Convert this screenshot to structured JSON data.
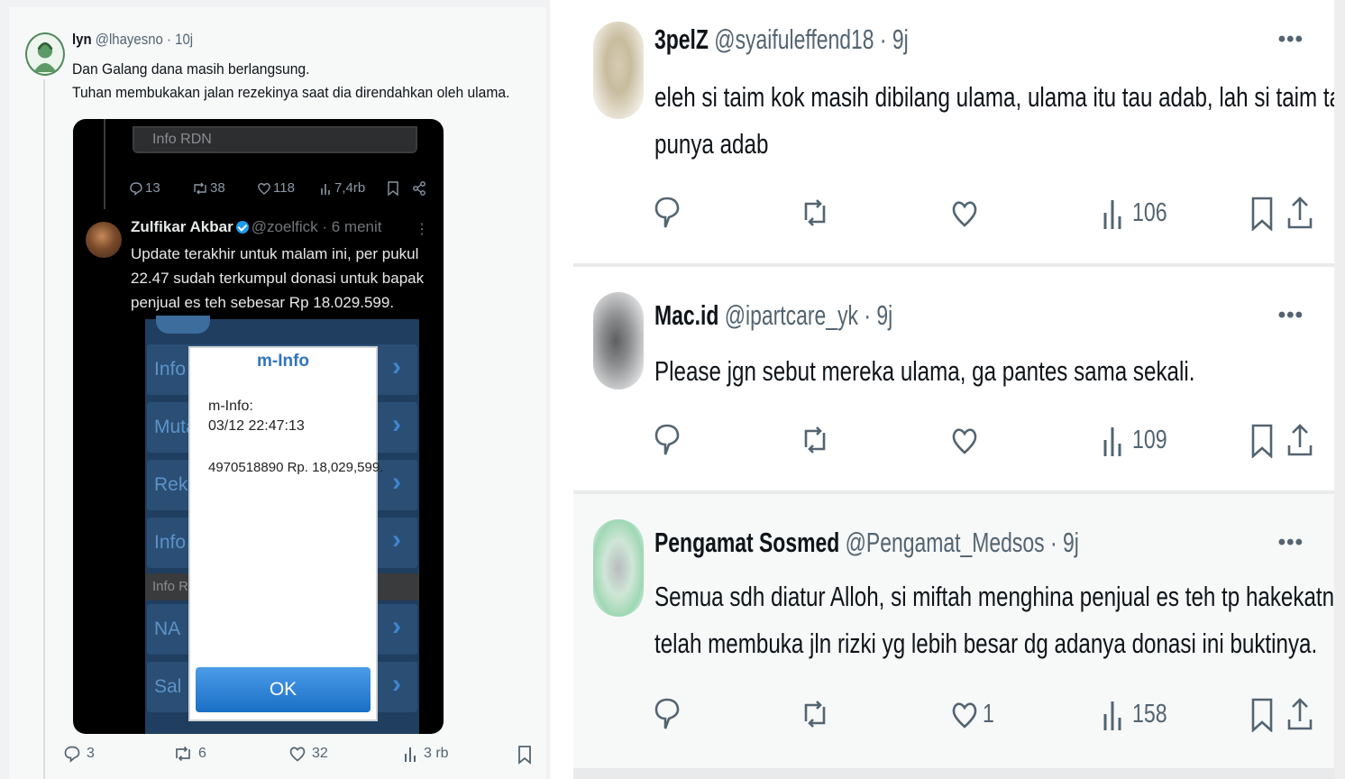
{
  "left_tweet": {
    "name": "lyn",
    "handle_time": "@lhayesno · 10j",
    "text_line1": "Dan Galang dana masih berlangsung.",
    "text_line2": "Tuhan membukakan jalan rezekinya saat dia direndahkan oleh ulama.",
    "media": {
      "top_bar_label": "Info RDN",
      "actions": {
        "replies": "13",
        "retweets": "38",
        "likes": "118",
        "views": "7,4rb"
      },
      "quoted_name": "Zulfikar Akbar",
      "quoted_handle_time": "@zoelfick · 6 menit",
      "quoted_text": "Update terakhir untuk malam ini, per pukul 22.47 sudah terkumpul donasi untuk bapak penjual es teh sebesar Rp 18.029.599.",
      "app_rows": [
        "Info",
        "Muta",
        "Reke",
        "Info",
        "NA",
        "Sal"
      ],
      "app_section": "Info R",
      "dialog": {
        "title": "m-Info",
        "line1": "m-Info:",
        "line2": "03/12 22:47:13",
        "line3": "4970518890 Rp. 18,029,599.",
        "ok": "OK"
      }
    },
    "actions": {
      "replies": "3",
      "retweets": "6",
      "likes": "32",
      "views": "3 rb"
    }
  },
  "replies": [
    {
      "name": "3pelZ",
      "handle_time": "@syaifuleffend18 · 9j",
      "text_lines": [
        "eleh si taim kok masih dibilang ulama, ulama itu tau adab, lah si taim tak",
        "punya adab"
      ],
      "likes": "",
      "views": "106"
    },
    {
      "name": "Mac.id",
      "handle_time": "@ipartcare_yk · 9j",
      "text_lines": [
        "Please jgn sebut mereka ulama, ga pantes sama sekali."
      ],
      "likes": "",
      "views": "109"
    },
    {
      "name": "Pengamat Sosmed",
      "handle_time": "@Pengamat_Medsos · 9j",
      "text_lines": [
        "Semua sdh diatur Alloh, si miftah menghina penjual es teh tp hakekatnya",
        "telah membuka jln rizki yg lebih besar dg adanya donasi ini buktinya."
      ],
      "likes": "1",
      "views": "158"
    }
  ],
  "more_label": "•••",
  "colors": {
    "text": "#0f1419",
    "muted": "#536471",
    "dark_bg": "#000000",
    "blue": "#1d9bf0"
  }
}
